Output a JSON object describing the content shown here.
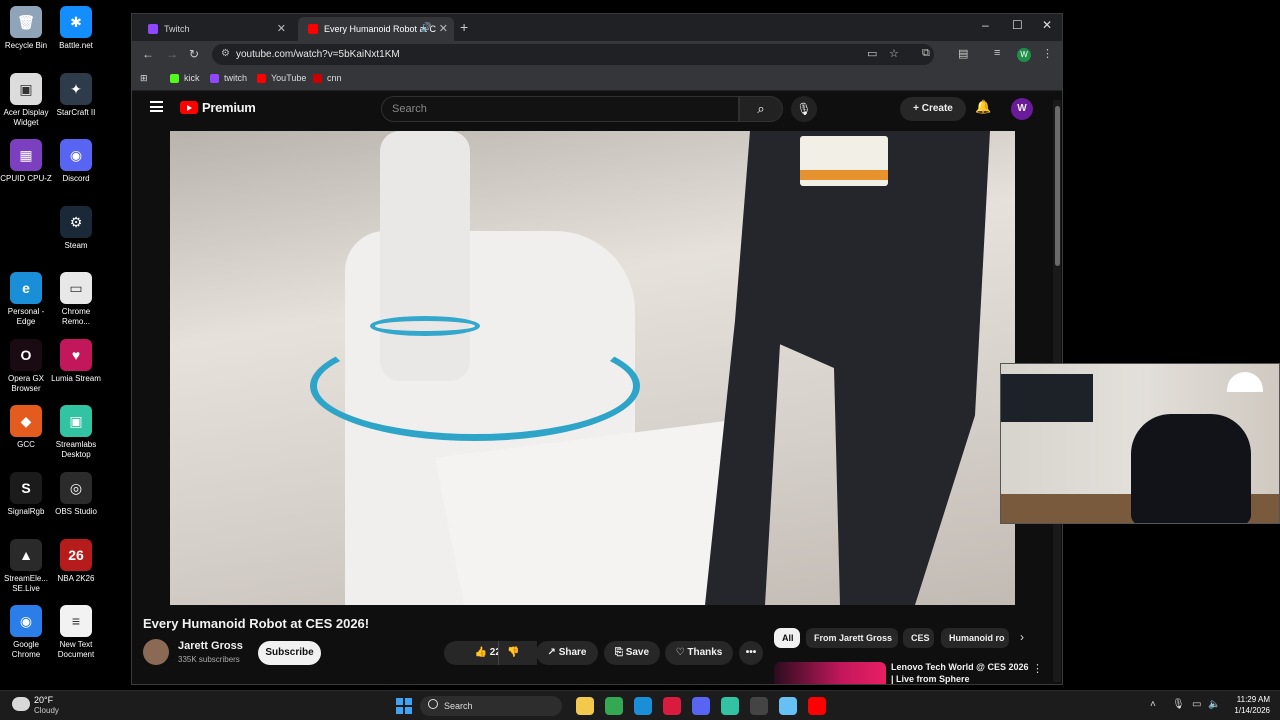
{
  "desktop": {
    "icons": [
      {
        "label": "Recycle Bin",
        "color": "#8fa4b8",
        "glyph": "🗑"
      },
      {
        "label": "Battle.net",
        "color": "#148eff",
        "glyph": "✱"
      },
      {
        "label": "Acer Display Widget",
        "color": "#dcdcdc",
        "glyph": "▣"
      },
      {
        "label": "StarCraft II",
        "color": "#2e3b4a",
        "glyph": "✦"
      },
      {
        "label": "CPUID CPU-Z",
        "color": "#7b3fbf",
        "glyph": "▦"
      },
      {
        "label": "Discord",
        "color": "#5865f2",
        "glyph": "◉"
      },
      {
        "label": "Steam",
        "color": "#1b2838",
        "glyph": "⚙"
      },
      {
        "label": "Personal - Edge",
        "color": "#1a8fd8",
        "glyph": "e"
      },
      {
        "label": "Chrome Remo...",
        "color": "#e8e8e8",
        "glyph": "▭"
      },
      {
        "label": "Opera GX Browser",
        "color": "#1a0b12",
        "glyph": "O"
      },
      {
        "label": "Lumia Stream",
        "color": "#c2185b",
        "glyph": "♥"
      },
      {
        "label": "GCC",
        "color": "#e35b1f",
        "glyph": "◆"
      },
      {
        "label": "Streamlabs Desktop",
        "color": "#31c3a2",
        "glyph": "▣"
      },
      {
        "label": "SignalRgb",
        "color": "#1b1b1b",
        "glyph": "S"
      },
      {
        "label": "OBS Studio",
        "color": "#2b2b2b",
        "glyph": "◎"
      },
      {
        "label": "StreamEle... SE.Live",
        "color": "#2a2a2a",
        "glyph": "▲"
      },
      {
        "label": "NBA 2K26",
        "color": "#b71c1c",
        "glyph": "26"
      },
      {
        "label": "Google Chrome",
        "color": "#2b7de9",
        "glyph": "◉"
      },
      {
        "label": "New Text Document",
        "color": "#f2f2f2",
        "glyph": "≡"
      }
    ]
  },
  "browser": {
    "tabs": [
      {
        "title": "Twitch",
        "color": "#9146ff"
      },
      {
        "title": "Every Humanoid Robot at C",
        "color": "#ff0000"
      }
    ],
    "url": "youtube.com/watch?v=5bKaiNxt1KM",
    "bookmarks": [
      {
        "label": "kick",
        "color": "#53fc18"
      },
      {
        "label": "twitch",
        "color": "#9146ff"
      },
      {
        "label": "YouTube",
        "color": "#ff0000"
      },
      {
        "label": "cnn",
        "color": "#cc0000"
      }
    ],
    "profile_initial": "W"
  },
  "youtube": {
    "logo_text": "Premium",
    "search_placeholder": "Search",
    "create_label": "Create",
    "avatar_initial": "W",
    "video_title": "Every Humanoid Robot at CES 2026!",
    "channel_name": "Jarett Gross",
    "subscribers": "335K subscribers",
    "subscribe_label": "Subscribe",
    "likes": "227",
    "share_label": "Share",
    "save_label": "Save",
    "thanks_label": "Thanks",
    "chips": [
      "All",
      "From Jarett Gross",
      "CES",
      "Humanoid ro"
    ],
    "recommended_title": "Lenovo Tech World @ CES 2026 | Live from Sphere"
  },
  "taskbar": {
    "temperature": "20°F",
    "weather": "Cloudy",
    "search_label": "Search",
    "time": "11:29 AM",
    "date": "1/14/2026",
    "apps": [
      {
        "name": "file-explorer",
        "color": "#f2c94c"
      },
      {
        "name": "chrome",
        "color": "#34a853"
      },
      {
        "name": "edge",
        "color": "#1a8fd8"
      },
      {
        "name": "opera-gx",
        "color": "#d81b3f"
      },
      {
        "name": "discord",
        "color": "#5865f2"
      },
      {
        "name": "streamlabs",
        "color": "#31c3a2"
      },
      {
        "name": "obs",
        "color": "#444444"
      },
      {
        "name": "steam",
        "color": "#66c0f4"
      },
      {
        "name": "youtube",
        "color": "#ff0000"
      }
    ]
  }
}
